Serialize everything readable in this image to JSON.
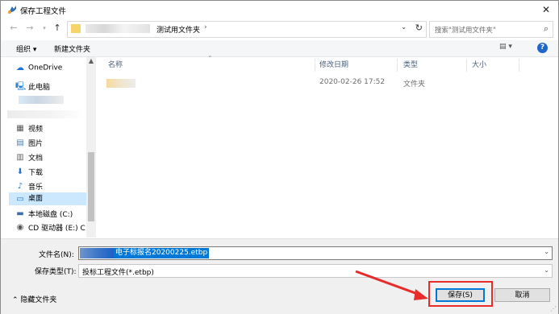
{
  "window": {
    "title": "保存工程文件",
    "close_glyph": "✕"
  },
  "address": {
    "crumb": "测试用文件夹",
    "chevron": "›",
    "search_placeholder": "搜索\"测试用文件夹\""
  },
  "toolbar": {
    "organize": "组织 ▾",
    "new_folder": "新建文件夹",
    "help": "?"
  },
  "nav": {
    "items": [
      {
        "label": "OneDrive",
        "icon": "cloud-icon",
        "glyph": "☁"
      },
      {
        "label": "此电脑",
        "icon": "computer-icon",
        "glyph": "🖳"
      },
      {
        "label": "视频",
        "icon": "video-icon",
        "glyph": "▦"
      },
      {
        "label": "图片",
        "icon": "pictures-icon",
        "glyph": "▤"
      },
      {
        "label": "文档",
        "icon": "documents-icon",
        "glyph": "▥"
      },
      {
        "label": "下载",
        "icon": "download-icon",
        "glyph": "⬇"
      },
      {
        "label": "音乐",
        "icon": "music-icon",
        "glyph": "♪"
      },
      {
        "label": "桌面",
        "icon": "desktop-icon",
        "glyph": "▭",
        "selected": true
      },
      {
        "label": "本地磁盘 (C:)",
        "icon": "drive-icon",
        "glyph": "▬"
      },
      {
        "label": "CD 驱动器 (E:) C",
        "icon": "cd-drive-icon",
        "glyph": "◉"
      }
    ]
  },
  "list": {
    "columns": [
      "名称",
      "修改日期",
      "类型",
      "大小"
    ],
    "rows": [
      {
        "date": "2020-02-26 17:52",
        "type": "文件夹"
      }
    ]
  },
  "form": {
    "filename_label": "文件名(N):",
    "filename_value_visible": "电子标报名20200225.etbp",
    "filetype_label": "保存类型(T):",
    "filetype_value": "投标工程文件(*.etbp)",
    "hide_folders": "隐藏文件夹",
    "save_button": "保存(S)",
    "cancel_button": "取消"
  },
  "colors": {
    "accent": "#0078d7",
    "highlight_box": "#e82b2b",
    "arrow": "#e82b2b"
  }
}
